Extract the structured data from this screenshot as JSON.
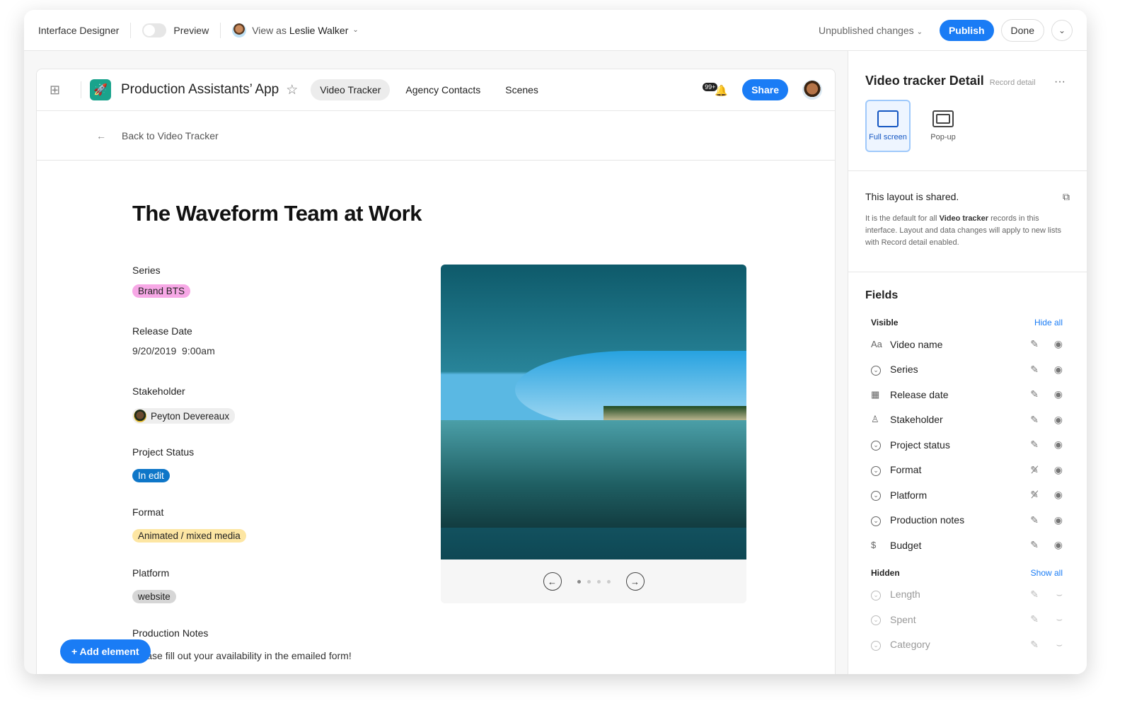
{
  "topbar": {
    "title": "Interface Designer",
    "preview_label": "Preview",
    "preview_on": false,
    "view_as_prefix": "View as",
    "view_as_user": "Leslie Walker",
    "unpublished": "Unpublished changes",
    "publish": "Publish",
    "done": "Done"
  },
  "app": {
    "title": "Production Assistants’ App",
    "tabs": [
      {
        "label": "Video Tracker",
        "active": true
      },
      {
        "label": "Agency Contacts"
      },
      {
        "label": "Scenes"
      }
    ],
    "notifications": "99+",
    "share": "Share"
  },
  "record": {
    "back": "Back to Video Tracker",
    "title": "The Waveform Team at Work",
    "fields": [
      {
        "label": "Series",
        "value": "Brand BTS",
        "color": "#f7a8e6"
      },
      {
        "label": "Release Date",
        "value": "9/20/2019  9:00am"
      },
      {
        "label": "Stakeholder",
        "value": "Peyton Devereaux",
        "color": "#eeeeee"
      },
      {
        "label": "Project Status",
        "value": "In edit",
        "color": "#0e76c8"
      },
      {
        "label": "Format",
        "value": "Animated / mixed media",
        "color": "#fde6a3"
      },
      {
        "label": "Platform",
        "value": "website",
        "color": "#d6d6d6"
      },
      {
        "label": "Production Notes",
        "value": "Please fill out your availability in the emailed form!"
      }
    ],
    "carousel": {
      "count": 4,
      "current": 1
    }
  },
  "add_element": "+ Add element",
  "panel": {
    "title": "Video tracker Detail",
    "subtitle": "Record detail",
    "layouts": [
      {
        "label": "Full screen",
        "selected": true
      },
      {
        "label": "Pop-up"
      }
    ],
    "shared_title": "This layout is shared.",
    "shared_pre": "It is the default for all ",
    "shared_bold": "Video tracker",
    "shared_post": " records in this interface. Layout and data changes will apply to new lists with Record detail enabled.",
    "fields_title": "Fields",
    "visible_label": "Visible",
    "hide_all": "Hide all",
    "hidden_label": "Hidden",
    "show_all": "Show all",
    "visible": [
      {
        "name": "Video name",
        "icon": "text-icon",
        "editable": true
      },
      {
        "name": "Series",
        "icon": "select-icon",
        "editable": true
      },
      {
        "name": "Release date",
        "icon": "calendar-icon",
        "editable": true
      },
      {
        "name": "Stakeholder",
        "icon": "user-icon",
        "editable": true
      },
      {
        "name": "Project status",
        "icon": "select-icon",
        "editable": true
      },
      {
        "name": "Format",
        "icon": "select-icon",
        "editable": false
      },
      {
        "name": "Platform",
        "icon": "select-icon",
        "editable": false
      },
      {
        "name": "Production notes",
        "icon": "select-icon",
        "editable": true
      },
      {
        "name": "Budget",
        "icon": "dollar-icon",
        "editable": true
      }
    ],
    "hidden": [
      {
        "name": "Length",
        "icon": "select-icon"
      },
      {
        "name": "Spent",
        "icon": "select-icon"
      },
      {
        "name": "Category",
        "icon": "select-icon"
      }
    ]
  },
  "colors": {
    "accent": "#1a7cf5",
    "app_logo": "#1aa38c"
  }
}
